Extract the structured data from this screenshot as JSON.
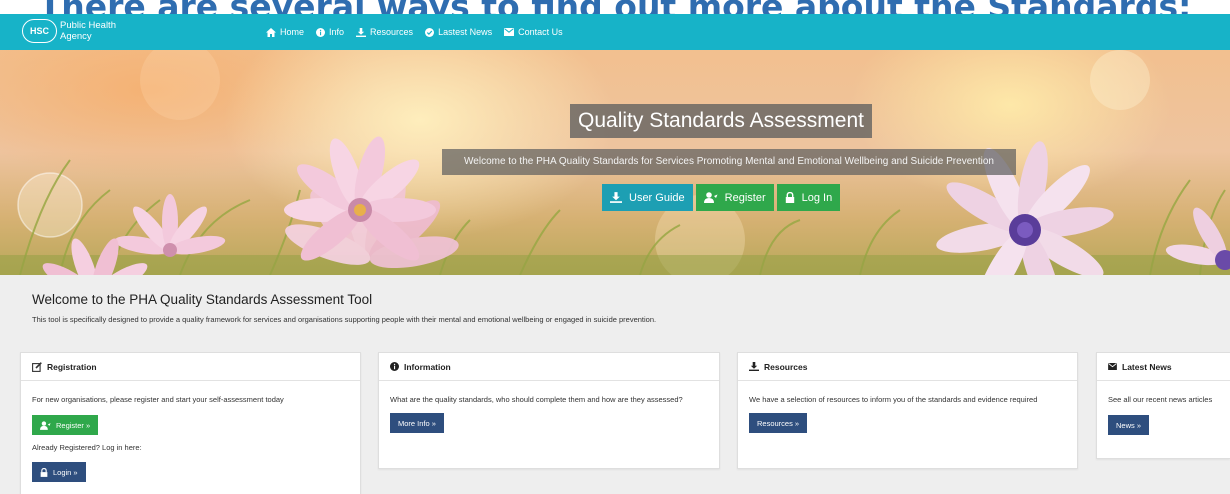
{
  "caption": "There are several ways to find out more about the Standards:",
  "brand": {
    "logo_text": "HSC",
    "line1": "Public Health",
    "line2": "Agency"
  },
  "nav": {
    "items": [
      {
        "label": "Home",
        "icon": "home-icon"
      },
      {
        "label": "Info",
        "icon": "info-icon"
      },
      {
        "label": "Resources",
        "icon": "download-icon"
      },
      {
        "label": "Lastest News",
        "icon": "check-circle-icon"
      },
      {
        "label": "Contact Us",
        "icon": "envelope-icon"
      }
    ]
  },
  "hero": {
    "title": "Quality Standards Assessment",
    "subtitle": "Welcome to the PHA Quality Standards for Services Promoting Mental and Emotional Wellbeing and Suicide Prevention",
    "buttons": [
      {
        "label": "User Guide",
        "icon": "download-icon"
      },
      {
        "label": "Register",
        "icon": "user-plus-icon"
      },
      {
        "label": "Log In",
        "icon": "lock-icon"
      }
    ]
  },
  "welcome": {
    "title": "Welcome to the PHA Quality Standards Assessment Tool",
    "text": "This tool is specifically designed to provide a quality framework for services and organisations supporting people with their mental and emotional wellbeing or engaged in suicide prevention."
  },
  "cards": {
    "registration": {
      "title": "Registration",
      "text": "For new organisations, please register and start your self-assessment today",
      "register_label": "Register »",
      "login_prompt": "Already Registered? Log in here:",
      "login_label": "Login »"
    },
    "information": {
      "title": "Information",
      "text": "What are the quality standards, who should complete them and how are they assessed?",
      "button_label": "More Info »"
    },
    "resources": {
      "title": "Resources",
      "text": "We have a selection of resources to inform you of the standards and evidence required",
      "button_label": "Resources »"
    },
    "news": {
      "title": "Latest News",
      "text": "See all our recent news articles",
      "button_label": "News »"
    }
  },
  "colors": {
    "navbar": "#17b3c8",
    "teal_button": "#1d9fb3",
    "green_button": "#2fa84b",
    "navy_button": "#2e4e7e",
    "caption": "#2f6db0"
  }
}
